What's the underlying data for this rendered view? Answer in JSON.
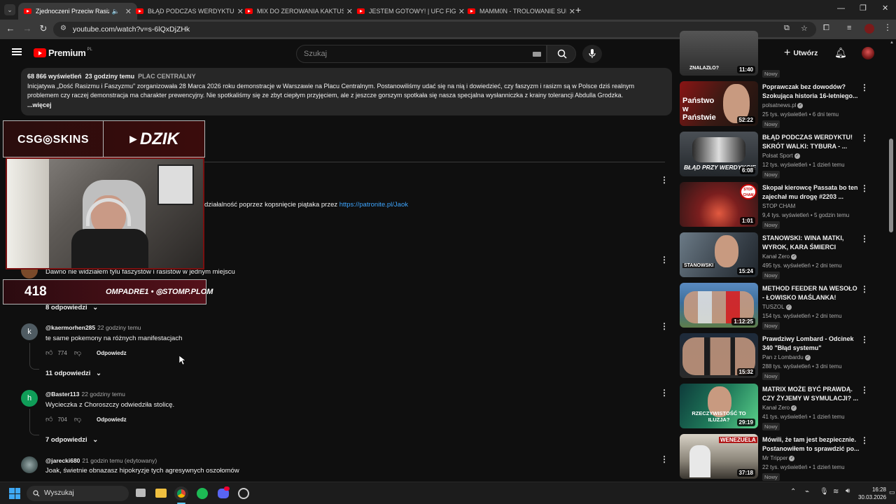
{
  "browser": {
    "tabs": [
      {
        "title": "Zjednoczeni Przeciw Rasizm",
        "active": true
      },
      {
        "title": "BŁĄD PODCZAS WERDYKTU! SI",
        "active": false
      },
      {
        "title": "MIX DO ZEROWANIA KAKTUSO",
        "active": false
      },
      {
        "title": "JESTEM GOTOWY! | UFC FIGHT",
        "active": false
      },
      {
        "title": "MAMM0N - TROLOWANIE SUF",
        "active": false
      }
    ],
    "url": "youtube.com/watch?v=s-6lQxDjZHk"
  },
  "youtube": {
    "logo_text": "Premium",
    "logo_sup": "PL",
    "search_placeholder": "Szukaj",
    "create_label": "Utwórz"
  },
  "description": {
    "views": "68 866 wyświetleń",
    "time": "23 godziny temu",
    "tag": "PLAC CENTRALNY",
    "text": "Inicjatywa „Dość Rasizmu i Faszyzmu\" zorganizowała 28 Marca 2026 roku demonstracje w Warszawie na Placu Centralnym. Postanowiliśmy udać się na nią i dowiedzieć, czy faszyzm i rasizm są w Polsce dziś realnym problemem czy raczej demonstracja ma charakter prewencyjny. Nie spotkaliśmy się ze zbyt ciepłym przyjęciem, ale z jeszcze gorszym spotkała się nasza specjalna wysłanniczka z krainy tolerancji Abdulla Grodzka.",
    "more": "...więcej"
  },
  "overlay": {
    "brand_left": "CSG◎SKINS",
    "brand_right": "DZIK",
    "count": "418",
    "ticker": "OMPADRE1 • ◎STOMP.PLOM"
  },
  "pinned": {
    "text_prefix": "działalność poprzez kopsnięcie piątaka przez ",
    "link": "https://patronite.pl/Jaok"
  },
  "comments": [
    {
      "text": "Dawno nie widziałem tylu faszystów i rasistów w jednym miejscu",
      "replies": "8 odpowiedzi"
    },
    {
      "avatar": "k",
      "avatar_color": "#4f5b62",
      "user": "@kaermorhen285",
      "time": "22 godziny temu",
      "text": "te same pokemony na różnych manifestacjach",
      "likes": "774",
      "reply_label": "Odpowiedz",
      "replies": "11 odpowiedzi"
    },
    {
      "avatar": "h",
      "avatar_color": "#0f9d58",
      "user": "@Baster113",
      "time": "22 godziny temu",
      "text": "Wycieczka z Choroszczy odwiedziła stolicę.",
      "likes": "704",
      "reply_label": "Odpowiedz",
      "replies": "7 odpowiedzi"
    },
    {
      "avatar": "",
      "avatar_color": "#5d6a6e",
      "user": "@jarecki680",
      "time": "21 godzin temu (edytowany)",
      "text": "Joak, świetnie obnazasz hipokryzje tych  agresywnych oszołomów"
    }
  ],
  "sidebar": [
    {
      "title": "ZNALAZŁO?",
      "duration": "11:40",
      "channel": "",
      "stats": "",
      "new": "Nowy",
      "colors": [
        "#3a3a3a",
        "#555"
      ]
    },
    {
      "title": "Poprawczak bez dowodów? Szokująca historia 16-letniego...",
      "duration": "52:22",
      "channel": "polsatnews.pl",
      "stats": "25 tys. wyświetleń • 6 dni temu",
      "new": "Nowy",
      "overlay_text": "Państwo w Państwie",
      "colors": [
        "#8a1414",
        "#2a1e1a"
      ]
    },
    {
      "title": "BŁĄD PODCZAS WERDYKTU! SKRÓT WALKI: TYBURA - ...",
      "duration": "6:08",
      "channel": "Polsat Sport",
      "stats": "12 tys. wyświetleń • 1 dzień temu",
      "new": "Nowy",
      "overlay_text": "BŁĄD PRZY WERDYKCIE",
      "colors": [
        "#3a3f45",
        "#111"
      ]
    },
    {
      "title": "Skopał kierowcę Passata bo ten zajechał mu drogę #2203 ...",
      "duration": "1:01",
      "channel": "STOP CHAM",
      "stats": "9,4 tys. wyświetleń • 5 godzin temu",
      "new": "Nowy",
      "overlay_text": "STOP CHAM",
      "colors": [
        "#5a1a1a",
        "#c73a2e"
      ]
    },
    {
      "title": "STANOWSKI: WINA MATKI, WYROK, KARA ŚMIERCI",
      "duration": "15:24",
      "channel": "Kanał Zero",
      "stats": "495 tys. wyświetleń • 2 dni temu",
      "new": "Nowy",
      "overlay_text": "STANOWSKI",
      "colors": [
        "#6b7a86",
        "#2a3038"
      ]
    },
    {
      "title": "METHOD FEEDER NA WESOŁO - ŁOWISKO MAŚLANKA!",
      "duration": "1:12:25",
      "channel": "TUSZOL",
      "stats": "154 tys. wyświetleń • 2 dni temu",
      "new": "Nowy",
      "colors": [
        "#3c6e9a",
        "#6a8f5a"
      ]
    },
    {
      "title": "Prawdziwy Lombard - Odcinek 340 \"Błąd systemu\"",
      "duration": "15:32",
      "channel": "Pan z Lombardu",
      "stats": "288 tys. wyświetleń • 3 dni temu",
      "new": "Nowy",
      "colors": [
        "#1d2a3a",
        "#4a4a4a"
      ]
    },
    {
      "title": "MATRIX MOŻE BYĆ PRAWDĄ. CZY ŻYJEMY W SYMULACJI? ...",
      "duration": "29:19",
      "channel": "Kanał Zero",
      "stats": "41 tys. wyświetleń • 1 dzień temu",
      "new": "Nowy",
      "overlay_text": "RZECZYWISTOŚĆ TO ILUZJA?",
      "colors": [
        "#0e3b3b",
        "#1f7a5a"
      ]
    },
    {
      "title": "Mówili, że tam jest bezpiecznie. Postanowiłem to sprawdzić po...",
      "duration": "37:18",
      "channel": "Mr Tripper",
      "stats": "22 tys. wyświetleń • 1 dzień temu",
      "new": "Nowy",
      "overlay_text": "WENEZUELA",
      "colors": [
        "#b8b2a6",
        "#4a4640"
      ]
    }
  ],
  "taskbar": {
    "search_label": "Wyszukaj",
    "time": "16:28",
    "date": "30.03.2026"
  }
}
